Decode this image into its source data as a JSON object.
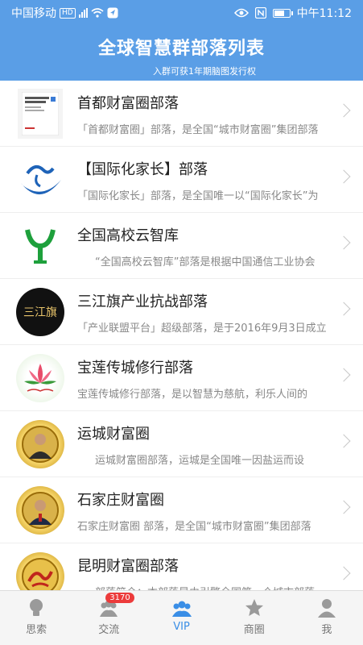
{
  "status_bar": {
    "carrier": "中国移动",
    "hd": "HD",
    "time": "中午11:12"
  },
  "header": {
    "title": "全球智慧群部落列表",
    "subtitle": "入群可获1年期脑图发行权"
  },
  "list": [
    {
      "name": "首都财富圈部落",
      "desc": "「首都财富圈」部落，是全国“城市财富圈”集团部落",
      "thumb": "book-cover",
      "indent": false
    },
    {
      "name": "【国际化家长】部落",
      "desc": "「国际化家长」部落，是全国唯一以“国际化家长”为",
      "thumb": "calligraphy-logo",
      "indent": false
    },
    {
      "name": "全国高校云智库",
      "desc": "“全国高校云智库”部落是根据中国通信工业协会",
      "thumb": "y-logo",
      "indent": true
    },
    {
      "name": "三江旗产业抗战部落",
      "desc": "「产业联盟平台」超级部落，是于2016年9月3日成立",
      "thumb": "sanjiangqi-badge",
      "thumb_text": "三江旗",
      "indent": false
    },
    {
      "name": "宝莲传城修行部落",
      "desc": "宝莲传城修行部落，是以智慧为慈航，利乐人间的",
      "thumb": "lotus-logo",
      "indent": false
    },
    {
      "name": "运城财富圈",
      "desc": "运城财富圈部落，运城是全国唯一因盐运而设",
      "thumb": "coin-portrait",
      "indent": true
    },
    {
      "name": "石家庄财富圈",
      "desc": "石家庄财富圈  部落，是全国“城市财富圈”集团部落",
      "thumb": "coin-portrait",
      "indent": false
    },
    {
      "name": "昆明财富圈部落",
      "desc": "部落简介：本部落是由引擎全国第一个城市部落",
      "thumb": "coin-calligraphy",
      "indent": false
    }
  ],
  "bottom_nav": [
    {
      "label": "思索",
      "icon": "lightbulb-icon",
      "active": false
    },
    {
      "label": "交流",
      "icon": "group-icon",
      "badge": "3170",
      "active": false
    },
    {
      "label": "VIP",
      "icon": "vip-people-icon",
      "active": true
    },
    {
      "label": "商圈",
      "icon": "star-icon",
      "active": false
    },
    {
      "label": "我",
      "icon": "person-icon",
      "active": false
    }
  ],
  "colors": {
    "header_bg": "#5a9ee6",
    "active_tab": "#3a8ee6",
    "badge": "#ec3b3b"
  }
}
